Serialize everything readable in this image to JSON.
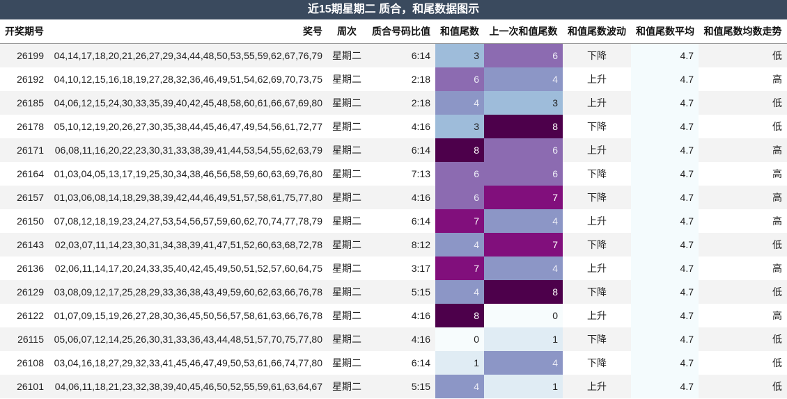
{
  "title": "近15期星期二 质合，和尾数据图示",
  "headers": [
    "开奖期号",
    "奖号",
    "周次",
    "质合号码比值",
    "和值尾数",
    "上一次和值尾数",
    "和值尾数波动",
    "和值尾数平均",
    "和值尾数均数走势"
  ],
  "colors": {
    "header_bg": "#3a4a5e",
    "scale": {
      "0": "#f7fcfd",
      "1": "#e0ecf4",
      "3": "#9ebcda",
      "4": "#8c96c6",
      "6": "#8c6bb1",
      "7": "#810f7c",
      "8": "#4d004b"
    }
  },
  "chart_data": {
    "type": "table",
    "title": "近15期星期二 质合，和尾数据图示",
    "columns": [
      "开奖期号",
      "奖号",
      "周次",
      "质合号码比值",
      "和值尾数",
      "上一次和值尾数",
      "和值尾数波动",
      "和值尾数平均",
      "和值尾数均数走势"
    ],
    "rows": [
      [
        "26199",
        "04,14,17,18,20,21,26,27,29,34,44,48,50,53,55,59,62,67,76,79",
        "星期二",
        "6:14",
        "3",
        "6",
        "下降",
        "4.7",
        "低"
      ],
      [
        "26192",
        "04,10,12,15,16,18,19,27,28,32,36,46,49,51,54,62,69,70,73,75",
        "星期二",
        "2:18",
        "6",
        "4",
        "上升",
        "4.7",
        "高"
      ],
      [
        "26185",
        "04,06,12,15,24,30,33,35,39,40,42,45,48,58,60,61,66,67,69,80",
        "星期二",
        "2:18",
        "4",
        "3",
        "上升",
        "4.7",
        "低"
      ],
      [
        "26178",
        "05,10,12,19,20,26,27,30,35,38,44,45,46,47,49,54,56,61,72,77",
        "星期二",
        "4:16",
        "3",
        "8",
        "下降",
        "4.7",
        "低"
      ],
      [
        "26171",
        "06,08,11,16,20,22,23,30,31,33,38,39,41,44,53,54,55,62,63,79",
        "星期二",
        "6:14",
        "8",
        "6",
        "上升",
        "4.7",
        "高"
      ],
      [
        "26164",
        "01,03,04,05,13,17,19,25,30,34,38,46,56,58,59,60,63,69,76,80",
        "星期二",
        "7:13",
        "6",
        "6",
        "下降",
        "4.7",
        "高"
      ],
      [
        "26157",
        "01,03,06,08,14,18,29,38,39,42,44,46,49,51,57,58,61,75,77,80",
        "星期二",
        "4:16",
        "6",
        "7",
        "下降",
        "4.7",
        "高"
      ],
      [
        "26150",
        "07,08,12,18,19,23,24,27,53,54,56,57,59,60,62,70,74,77,78,79",
        "星期二",
        "6:14",
        "7",
        "4",
        "上升",
        "4.7",
        "高"
      ],
      [
        "26143",
        "02,03,07,11,14,23,30,31,34,38,39,41,47,51,52,60,63,68,72,78",
        "星期二",
        "8:12",
        "4",
        "7",
        "下降",
        "4.7",
        "低"
      ],
      [
        "26136",
        "02,06,11,14,17,20,24,33,35,40,42,45,49,50,51,52,57,60,64,75",
        "星期二",
        "3:17",
        "7",
        "4",
        "上升",
        "4.7",
        "高"
      ],
      [
        "26129",
        "03,08,09,12,17,25,28,29,33,36,38,43,49,59,60,62,63,66,76,78",
        "星期二",
        "5:15",
        "4",
        "8",
        "下降",
        "4.7",
        "低"
      ],
      [
        "26122",
        "01,07,09,15,19,26,27,28,30,36,45,50,56,57,58,61,63,66,76,78",
        "星期二",
        "4:16",
        "8",
        "0",
        "上升",
        "4.7",
        "高"
      ],
      [
        "26115",
        "05,06,07,12,14,25,26,30,31,33,36,43,44,48,51,57,70,75,77,80",
        "星期二",
        "4:16",
        "0",
        "1",
        "下降",
        "4.7",
        "低"
      ],
      [
        "26108",
        "03,04,16,18,27,29,32,33,41,45,46,47,49,50,53,61,66,74,77,80",
        "星期二",
        "6:14",
        "1",
        "4",
        "下降",
        "4.7",
        "低"
      ],
      [
        "26101",
        "04,06,11,18,21,23,32,38,39,40,45,46,50,52,55,59,61,63,64,67",
        "星期二",
        "5:15",
        "4",
        "1",
        "上升",
        "4.7",
        "低"
      ]
    ]
  }
}
